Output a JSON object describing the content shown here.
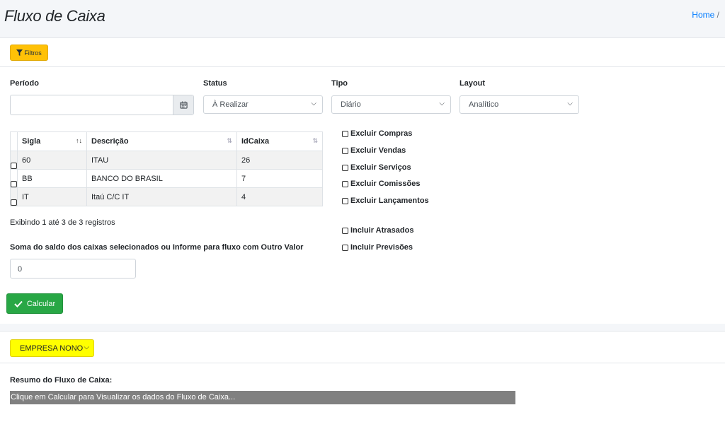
{
  "header": {
    "title": "Fluxo de Caixa",
    "breadcrumb_home": "Home",
    "breadcrumb_sep": "/"
  },
  "filters_button": {
    "label": "Filtros",
    "icon": "filter-icon"
  },
  "fields": {
    "periodo_label": "Período",
    "periodo_value": "",
    "status_label": "Status",
    "status_value": "À Realizar",
    "tipo_label": "Tipo",
    "tipo_value": "Diário",
    "layout_label": "Layout",
    "layout_value": "Analítico"
  },
  "table": {
    "headers": [
      "Sigla",
      "Descrição",
      "IdCaixa"
    ],
    "rows": [
      {
        "sigla": "60",
        "descricao": "ITAU",
        "idcaixa": "26"
      },
      {
        "sigla": "BB",
        "descricao": "BANCO DO BRASIL",
        "idcaixa": "7"
      },
      {
        "sigla": "IT",
        "descricao": "Itaú C/C IT",
        "idcaixa": "4"
      }
    ],
    "info": "Exibindo 1 até 3 de 3 registros"
  },
  "checkboxes": [
    "Excluir Compras",
    "Excluir Vendas",
    "Excluir Serviços",
    "Excluir Comissões",
    "Excluir Lançamentos",
    "Incluir Atrasados",
    "Incluir Previsões"
  ],
  "sum": {
    "label": "Soma do saldo dos caixas selecionados ou Informe para fluxo com Outro Valor",
    "value": "0"
  },
  "calc_button": {
    "label": "Calcular"
  },
  "empresa_select": {
    "value": "EMPRESA NONO"
  },
  "resumo": {
    "title": "Resumo do Fluxo de Caixa:",
    "message": "Clique em Calcular para Visualizar os dados do Fluxo de Caixa..."
  },
  "colors": {
    "filter_btn": "#ffc107",
    "calc_btn": "#28a745",
    "empresa_bg": "#ffff00",
    "resumo_bar": "#808080"
  }
}
